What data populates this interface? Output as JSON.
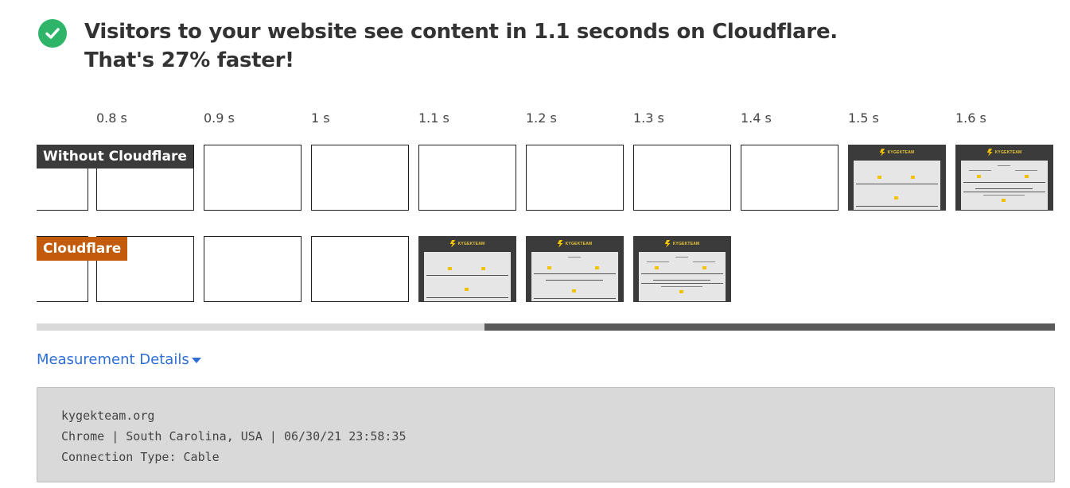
{
  "headline": {
    "line1": "Visitors to your website see content in 1.1 seconds on Cloudflare.",
    "line2": "That's 27% faster!",
    "icon": "check-circle-icon",
    "icon_color": "#2fb56a"
  },
  "timeline": {
    "labels": [
      "0.8 s",
      "0.9 s",
      "1 s",
      "1.1 s",
      "1.2 s",
      "1.3 s",
      "1.4 s",
      "1.5 s",
      "1.6 s"
    ]
  },
  "rows": {
    "without_label": "Without Cloudflare",
    "without_color": "#3b3b3b",
    "cloudflare_label": "Cloudflare",
    "cloudflare_color": "#c25c0c"
  },
  "frame_logo_text": "KYGEKTEAM",
  "progress": {
    "filled_fraction": 0.56
  },
  "details": {
    "link_label": "Measurement Details",
    "lines": [
      "kygekteam.org",
      "Chrome | South Carolina, USA | 06/30/21 23:58:35",
      "Connection Type: Cable"
    ]
  }
}
